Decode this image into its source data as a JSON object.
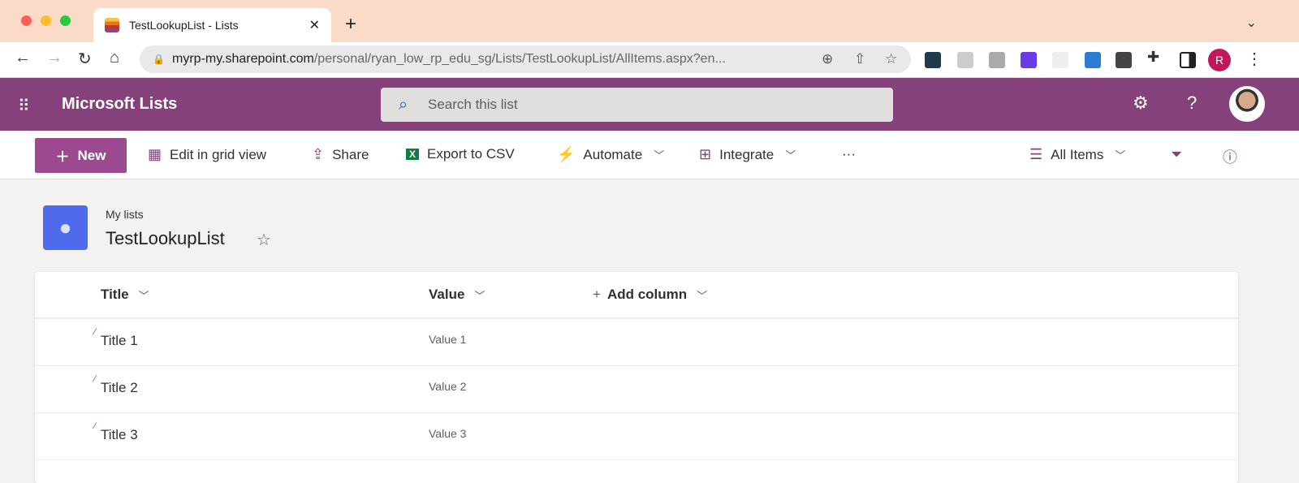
{
  "browser": {
    "tab_title": "TestLookupList - Lists",
    "url_host": "myrp-my.sharepoint.com",
    "url_path": "/personal/ryan_low_rp_edu_sg/Lists/TestLookupList/AllItems.aspx?en...",
    "profile_initial": "R"
  },
  "suite": {
    "app_title": "Microsoft Lists",
    "search_placeholder": "Search this list"
  },
  "commands": {
    "new": "New",
    "edit_grid": "Edit in grid view",
    "share": "Share",
    "export": "Export to CSV",
    "automate": "Automate",
    "integrate": "Integrate",
    "more": "···",
    "view": "All Items"
  },
  "list": {
    "breadcrumb": "My lists",
    "title": "TestLookupList"
  },
  "columns": [
    "Title",
    "Value",
    "Add column"
  ],
  "rows": [
    {
      "title": "Title 1",
      "value": "Value 1"
    },
    {
      "title": "Title 2",
      "value": "Value 2"
    },
    {
      "title": "Title 3",
      "value": "Value 3"
    }
  ],
  "colors": {
    "suite_bar": "#854179",
    "accent": "#9b4a8f",
    "list_icon": "#4f6bed"
  }
}
